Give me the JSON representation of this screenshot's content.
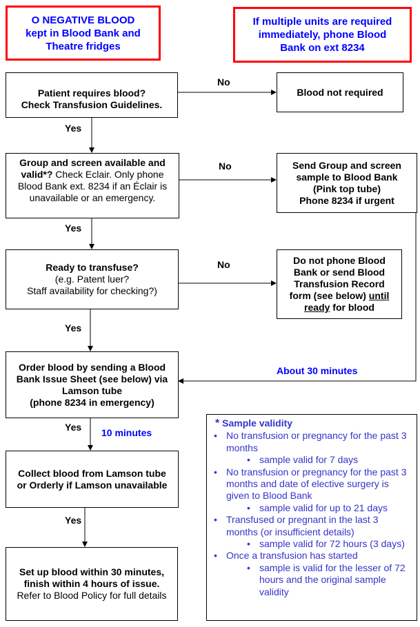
{
  "notes": {
    "o_negative": [
      "O NEGATIVE BLOOD",
      "kept in Blood Bank and",
      "Theatre fridges"
    ],
    "multiple_units": [
      "If multiple units are required",
      "immediately, phone Blood",
      "Bank on ext 8234"
    ]
  },
  "steps": {
    "requires_blood": [
      "Patient requires blood?",
      "Check Transfusion Guidelines."
    ],
    "not_required": "Blood not required",
    "group_screen": {
      "bold": "Group and screen available and valid*?",
      "rest": " Check Eclair. Only phone Blood Bank ext. 8234 if an Éclair is unavailable or an emergency."
    },
    "send_sample": [
      "Send Group and screen",
      "sample to Blood Bank",
      "(Pink top tube)",
      "Phone 8234 if urgent"
    ],
    "ready": {
      "bold": "Ready to transfuse?",
      "lines": [
        "(e.g. Patent luer?",
        "Staff availability for checking?)"
      ]
    },
    "do_not_phone": {
      "text": "Do not phone Blood Bank or send Blood Transfusion Record form (see below) ",
      "underlined": "until ready",
      "end": " for blood"
    },
    "order_blood": [
      "Order blood by sending a Blood",
      "Bank Issue Sheet (see below) via",
      "Lamson tube",
      "(phone 8234 in emergency)"
    ],
    "collect": [
      "Collect blood from Lamson tube",
      "or Orderly if Lamson unavailable"
    ],
    "setup": {
      "bold": [
        "Set up blood within 30 minutes,",
        "finish within 4 hours of issue."
      ],
      "rest": "Refer to Blood Policy for full details"
    }
  },
  "labels": {
    "yes": "Yes",
    "no": "No",
    "about_30": "About 30 minutes",
    "ten_min": "10 minutes"
  },
  "validity": {
    "title": "Sample validity",
    "asterisk": "*",
    "items": [
      {
        "text": "No transfusion or pregnancy for the past 3 months",
        "sub": "sample valid for 7 days"
      },
      {
        "text": "No transfusion or pregnancy for the past 3 months and date of elective surgery is given to Blood Bank",
        "sub": "sample valid for up to 21 days"
      },
      {
        "text": "Transfused or pregnant in the last 3 months (or insufficient details)",
        "sub": "sample valid for 72 hours (3 days)"
      },
      {
        "text": "Once a transfusion has started",
        "sub": "sample is valid for the lesser of 72 hours and the original sample validity"
      }
    ]
  },
  "colors": {
    "alert_border": "#ff0000",
    "note_text": "#0000ff",
    "validity_text": "#3333cc"
  }
}
